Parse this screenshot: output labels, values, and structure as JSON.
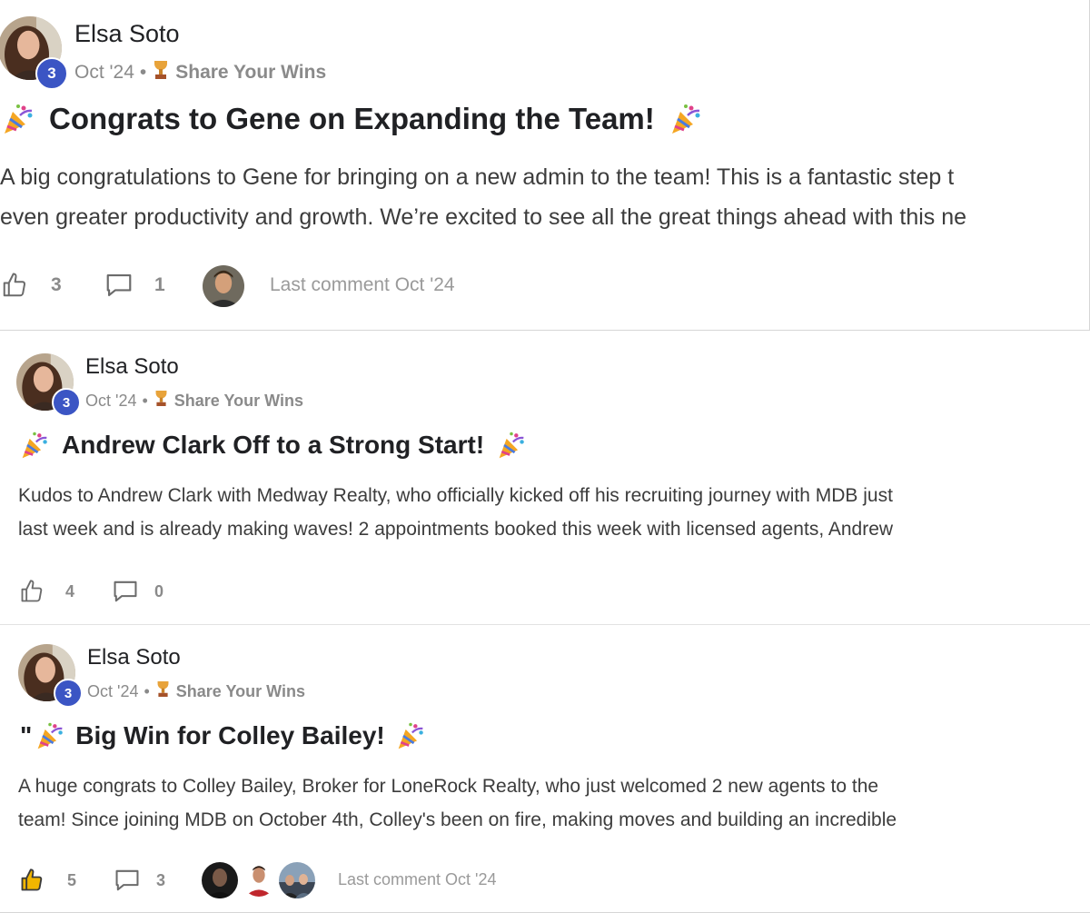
{
  "posts": [
    {
      "author": "Elsa Soto",
      "level": "3",
      "date": "Oct '24",
      "separator": "•",
      "category": "Share Your Wins",
      "title_prefix": "",
      "title": "Congrats to Gene on Expanding the Team!",
      "body_line_1": "A big congratulations to Gene for bringing on a new admin to the team! This is a fantastic step t",
      "body_line_2": "even greater productivity and growth. We’re excited to see all the great things ahead with this ne",
      "likes": "3",
      "comments": "1",
      "last_comment": "Last comment Oct '24"
    },
    {
      "author": "Elsa Soto",
      "level": "3",
      "date": "Oct '24",
      "separator": "•",
      "category": "Share Your Wins",
      "title_prefix": "",
      "title": "Andrew Clark Off to a Strong Start!",
      "body_line_1": "Kudos to Andrew Clark with Medway Realty, who officially kicked off his recruiting journey with MDB just",
      "body_line_2": "last week and is already making waves! 2 appointments booked this week with licensed agents, Andrew",
      "likes": "4",
      "comments": "0",
      "last_comment": ""
    },
    {
      "author": "Elsa Soto",
      "level": "3",
      "date": "Oct '24",
      "separator": "•",
      "category": "Share Your Wins",
      "title_prefix": "\"",
      "title": "Big Win for Colley Bailey!",
      "body_line_1": "A huge congrats to Colley Bailey, Broker for LoneRock Realty, who just welcomed 2 new agents to the",
      "body_line_2": "team! Since joining MDB on October 4th, Colley's been on fire, making moves and building an incredible",
      "likes": "5",
      "comments": "3",
      "last_comment": "Last comment Oct '24"
    }
  ],
  "colors": {
    "level_badge": "#3b55c4",
    "meta_text": "#8a8a8a",
    "like_active": "#f2b600"
  },
  "icons": [
    "party-popper-icon",
    "trophy-icon",
    "thumbs-up-icon",
    "comment-icon"
  ]
}
